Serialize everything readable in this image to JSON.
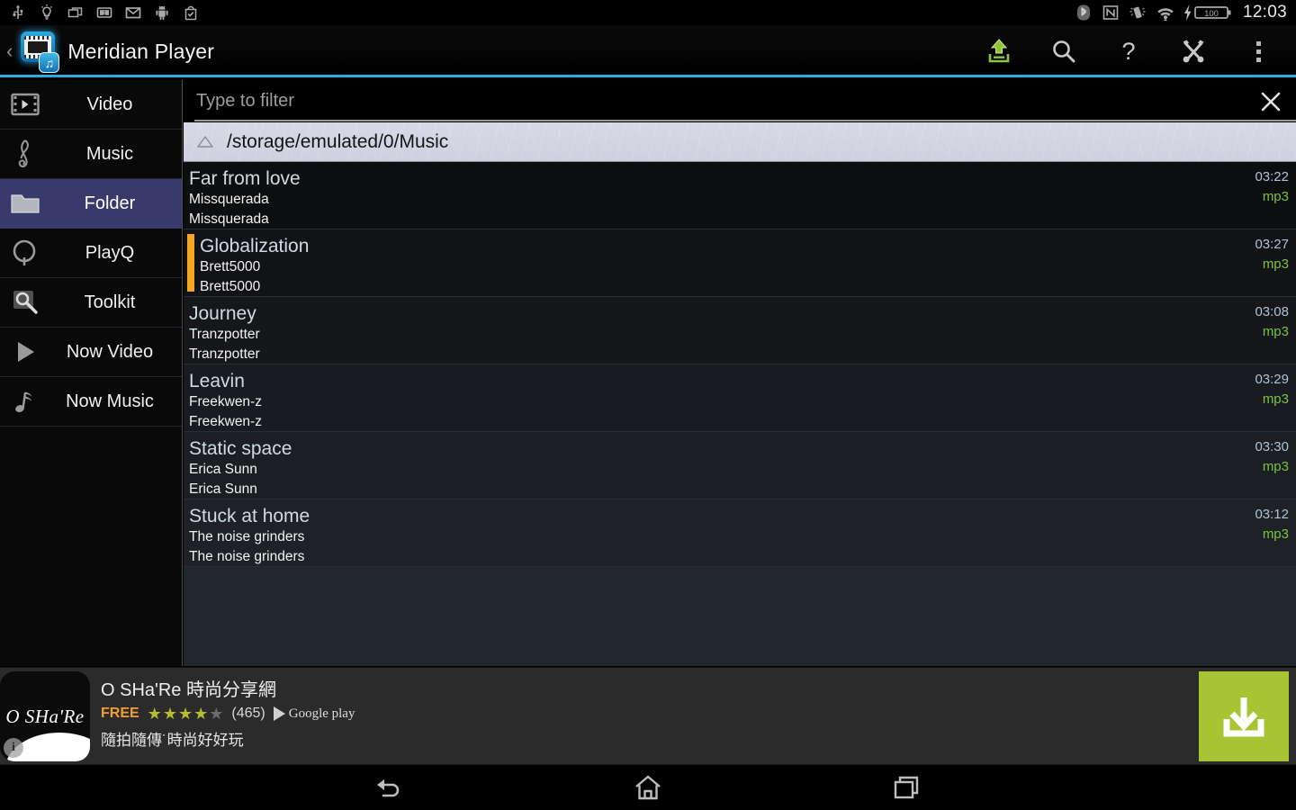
{
  "statusbar": {
    "icons": [
      "usb-icon",
      "bulb-icon",
      "screencast-icon",
      "sdcard-icon",
      "gmail-icon",
      "android-icon",
      "playstore-icon"
    ],
    "right_icons": [
      "bluetooth-icon",
      "nfc-icon",
      "vibrate-icon",
      "wifi-icon",
      "charging-icon"
    ],
    "battery_level": "100",
    "clock": "12:03"
  },
  "actionbar": {
    "back_glyph": "‹",
    "title": "Meridian Player",
    "app_icon": "meridian-app-icon",
    "actions": [
      {
        "name": "eject-icon",
        "label": "Eject"
      },
      {
        "name": "search-icon",
        "label": "Search"
      },
      {
        "name": "help-icon",
        "label": "Help"
      },
      {
        "name": "tools-icon",
        "label": "Tools"
      },
      {
        "name": "overflow-icon",
        "label": "More options"
      }
    ]
  },
  "sidebar": {
    "items": [
      {
        "label": "Video",
        "icon": "film-icon",
        "selected": false
      },
      {
        "label": "Music",
        "icon": "treble-clef-icon",
        "selected": false
      },
      {
        "label": "Folder",
        "icon": "folder-icon",
        "selected": true
      },
      {
        "label": "PlayQ",
        "icon": "queue-q-icon",
        "selected": false
      },
      {
        "label": "Toolkit",
        "icon": "wrench-search-icon",
        "selected": false
      },
      {
        "label": "Now Video",
        "icon": "play-icon",
        "selected": false
      },
      {
        "label": "Now Music",
        "icon": "music-note-icon",
        "selected": false
      }
    ],
    "selected_color": "#373a6b"
  },
  "filter": {
    "value": "",
    "placeholder": "Type to filter",
    "clear_icon": "close-icon"
  },
  "path": {
    "up_icon": "arrow-up-icon",
    "text": "/storage/emulated/0/Music"
  },
  "tracks": [
    {
      "title": "Far from love",
      "artist": "Missquerada",
      "album": "Missquerada",
      "duration": "03:22",
      "format": "mp3",
      "playing": false
    },
    {
      "title": "Globalization",
      "artist": "Brett5000",
      "album": "Brett5000",
      "duration": "03:27",
      "format": "mp3",
      "playing": true
    },
    {
      "title": "Journey",
      "artist": "Tranzpotter",
      "album": "Tranzpotter",
      "duration": "03:08",
      "format": "mp3",
      "playing": false
    },
    {
      "title": "Leavin",
      "artist": "Freekwen-z",
      "album": "Freekwen-z",
      "duration": "03:29",
      "format": "mp3",
      "playing": false
    },
    {
      "title": "Static space",
      "artist": "Erica Sunn",
      "album": "Erica Sunn",
      "duration": "03:30",
      "format": "mp3",
      "playing": false
    },
    {
      "title": "Stuck at home",
      "artist": "The noise grinders",
      "album": "The noise grinders",
      "duration": "03:12",
      "format": "mp3",
      "playing": false
    }
  ],
  "colors": {
    "accent_line": "#2aace0",
    "now_playing_marker": "#f5a623",
    "format_green": "#7cc242",
    "cta_green": "#a9c433"
  },
  "ad": {
    "thumb_brand": "O SHa'Re",
    "info_glyph": "i",
    "title": "O SHa'Re 時尚分享網",
    "price": "FREE",
    "stars_filled": 4,
    "stars_total": 5,
    "rating_count": "(465)",
    "store": "Google play",
    "subtitle": "隨拍隨傳˙時尚好好玩",
    "cta_icon": "download-icon"
  },
  "navbar": {
    "buttons": [
      {
        "name": "back-button",
        "icon": "back-arrow-icon"
      },
      {
        "name": "home-button",
        "icon": "home-icon"
      },
      {
        "name": "recents-button",
        "icon": "recents-icon"
      }
    ]
  }
}
